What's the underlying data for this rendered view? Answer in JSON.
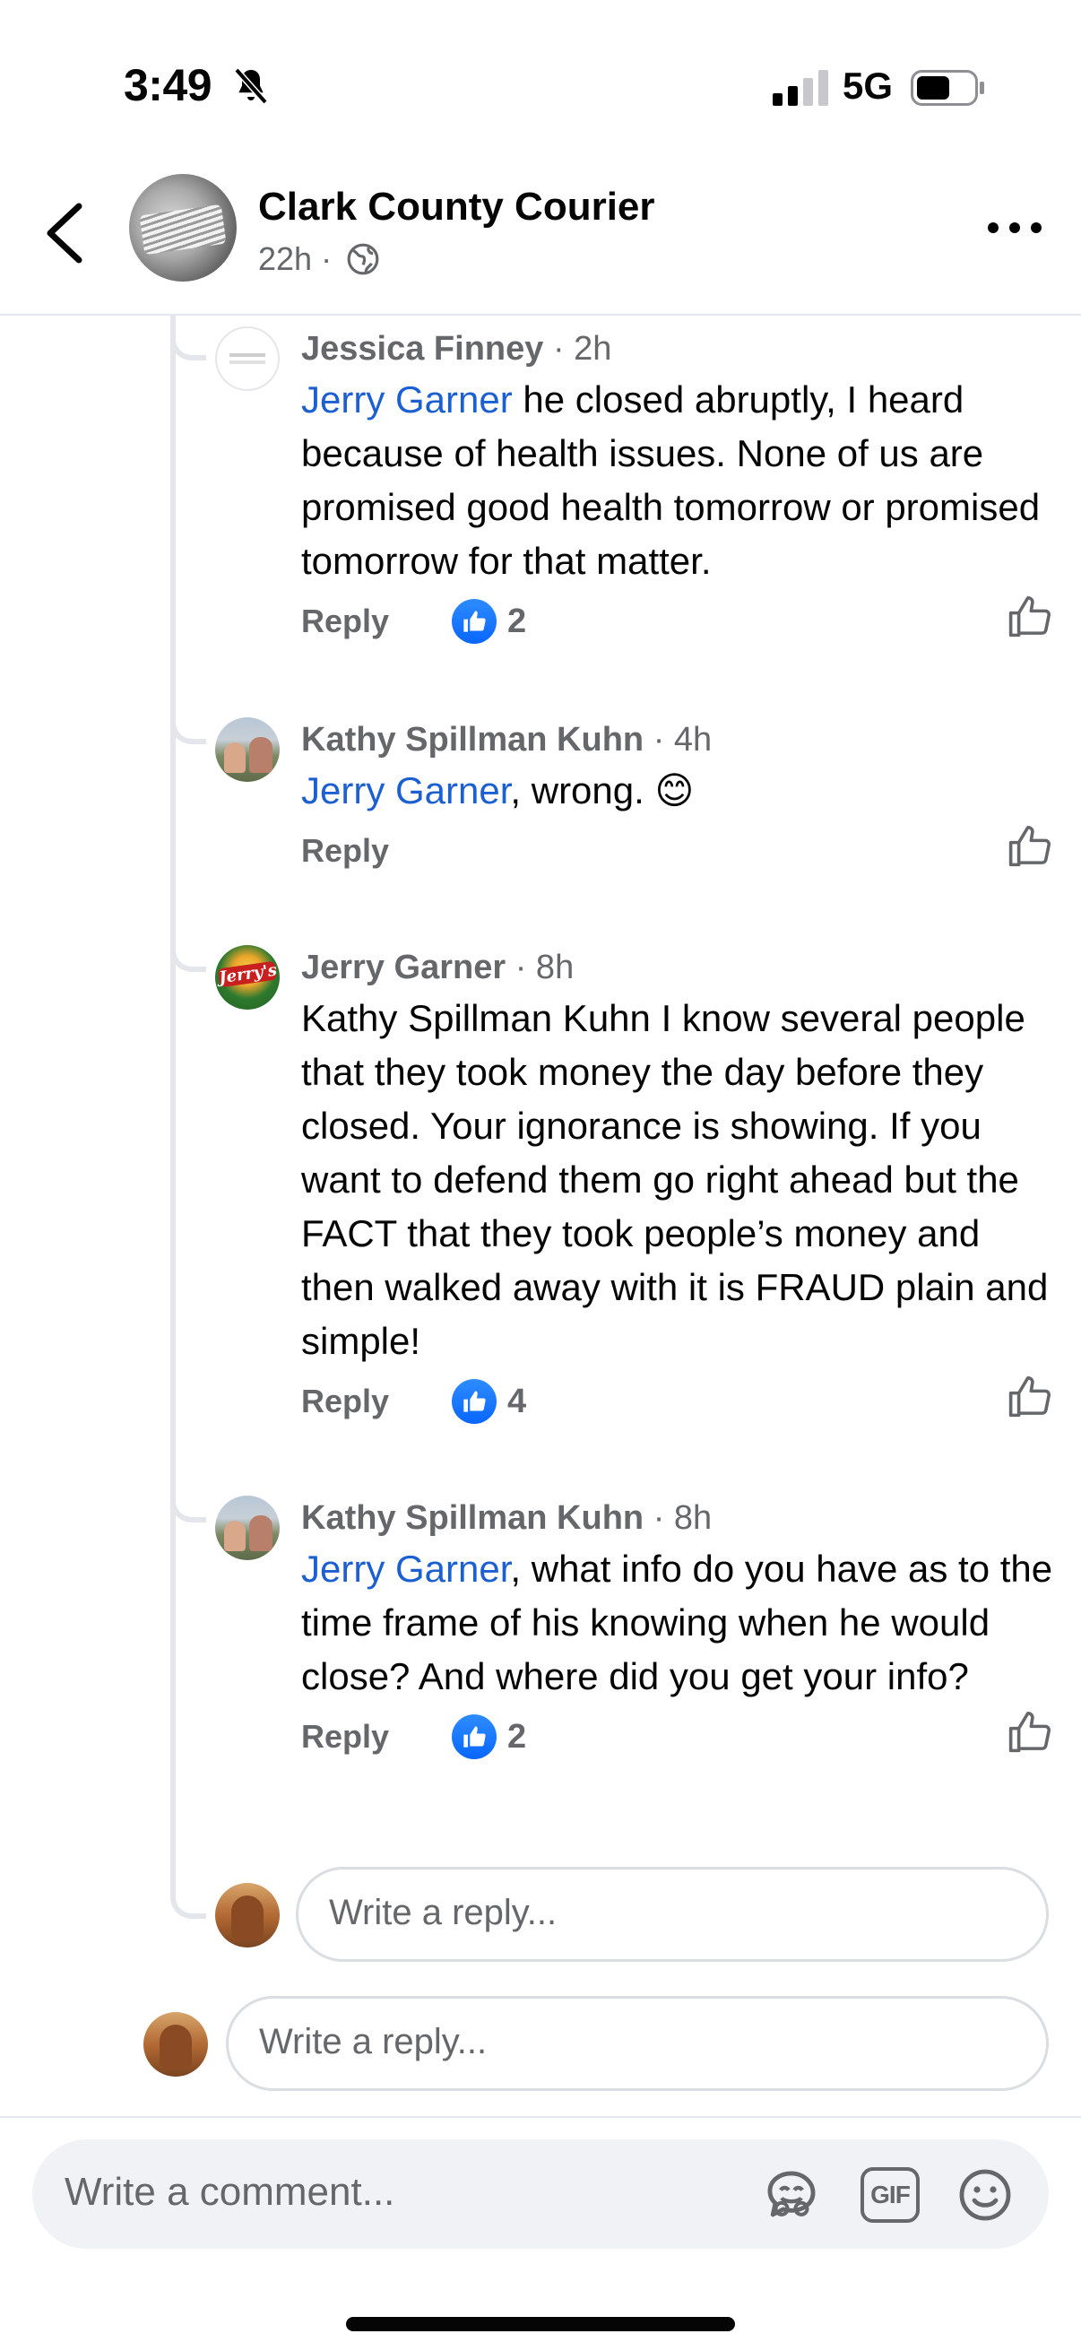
{
  "status_bar": {
    "time": "3:49",
    "network": "5G"
  },
  "header": {
    "page_name": "Clark County Courier",
    "meta": "22h ·"
  },
  "comments": [
    {
      "author": "Jessica Finney",
      "time": "· 2h",
      "mention": "Jerry Garner",
      "text": " he closed abruptly, I heard because of health issues. None of us are promised good health tomorrow or promised tomorrow for that matter.",
      "reply_label": "Reply",
      "likes": "2"
    },
    {
      "author": "Kathy Spillman Kuhn",
      "time": "· 4h",
      "mention": "Jerry Garner",
      "text": ", wrong. 😊",
      "reply_label": "Reply",
      "likes": ""
    },
    {
      "author": "Jerry Garner",
      "time": "· 8h",
      "mention": "",
      "text": "Kathy Spillman Kuhn I know several people that they took money the day before they closed. Your ignorance is showing. If you want to defend them go right ahead but the FACT that they took people’s money and then walked away with it is FRAUD plain and simple!",
      "reply_label": "Reply",
      "likes": "4"
    },
    {
      "author": "Kathy Spillman Kuhn",
      "time": "· 8h",
      "mention": "Jerry Garner",
      "text": ", what info do you have as to the time frame of his knowing when he would close? And where did you get your info?",
      "reply_label": "Reply",
      "likes": "2"
    }
  ],
  "reply_inputs": [
    {
      "placeholder": "Write a reply..."
    },
    {
      "placeholder": "Write a reply..."
    }
  ],
  "composer": {
    "placeholder": "Write a comment...",
    "gif_label": "GIF"
  },
  "colors": {
    "accent": "#0866ff",
    "mention": "#1b5fd1",
    "muted": "#65676b",
    "divider": "#e4e6eb"
  },
  "icons": [
    "bell-off-icon",
    "signal-icon",
    "battery-icon",
    "back-icon",
    "globe-icon",
    "more-icon",
    "like-icon",
    "avatar-sticker-icon",
    "gif-icon",
    "emoji-icon"
  ]
}
